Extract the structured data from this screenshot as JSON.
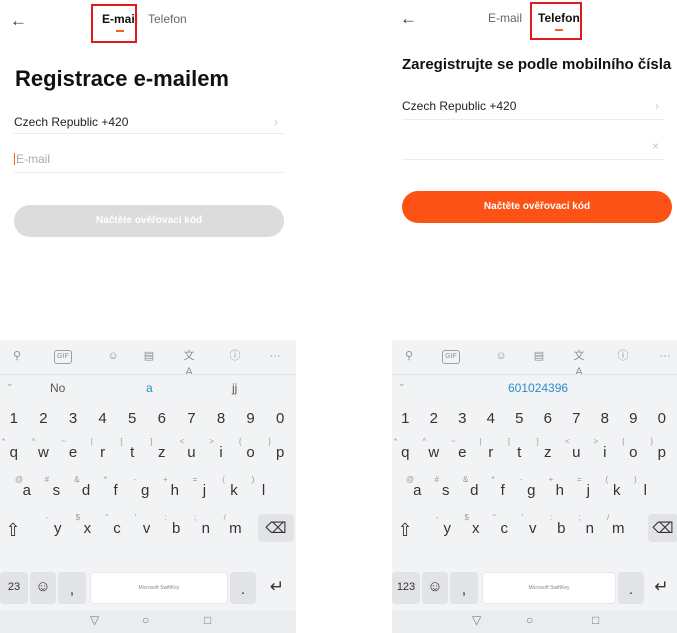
{
  "left": {
    "tabs": {
      "email": "E-mail",
      "phone": "Telefon"
    },
    "title": "Registrace e-mailem",
    "country": "Czech Republic +420",
    "email_placeholder": "E-mail",
    "submit": "Načtěte ověřovací kód",
    "keyboard": {
      "suggestions": [
        "No",
        "a",
        "jj"
      ],
      "numbers": [
        "1",
        "2",
        "3",
        "4",
        "5",
        "6",
        "7",
        "8",
        "9",
        "0"
      ],
      "row1": [
        [
          "*",
          "q"
        ],
        [
          "^",
          "w"
        ],
        [
          "~",
          "e"
        ],
        [
          "|",
          "r"
        ],
        [
          "[",
          "t"
        ],
        [
          "]",
          "z"
        ],
        [
          "<",
          "u"
        ],
        [
          ">",
          "i"
        ],
        [
          "{",
          "o"
        ],
        [
          "}",
          "p"
        ]
      ],
      "row2": [
        [
          "@",
          "a"
        ],
        [
          "#",
          "s"
        ],
        [
          "&",
          "d"
        ],
        [
          "*",
          "f"
        ],
        [
          "-",
          "g"
        ],
        [
          "+",
          "h"
        ],
        [
          "=",
          "j"
        ],
        [
          "(",
          "k"
        ],
        [
          ")",
          "l"
        ]
      ],
      "row3": [
        [
          "-",
          "y"
        ],
        [
          "$",
          "x"
        ],
        [
          "\"",
          "c"
        ],
        [
          "'",
          "v"
        ],
        [
          ":",
          "b"
        ],
        [
          ";",
          "n"
        ],
        [
          "/",
          "m"
        ]
      ],
      "num_toggle": "23",
      "space_label": "Microsoft SwiftKey",
      "comma": ",",
      "period": "."
    }
  },
  "right": {
    "tabs": {
      "email": "E-mail",
      "phone": "Telefon"
    },
    "title": "Zaregistrujte se podle mobilního čísla",
    "country": "Czech Republic +420",
    "submit": "Načtěte ověřovací kód",
    "keyboard": {
      "suggestion": "601024396",
      "numbers": [
        "1",
        "2",
        "3",
        "4",
        "5",
        "6",
        "7",
        "8",
        "9",
        "0"
      ],
      "row1": [
        [
          "*",
          "q"
        ],
        [
          "^",
          "w"
        ],
        [
          "~",
          "e"
        ],
        [
          "|",
          "r"
        ],
        [
          "[",
          "t"
        ],
        [
          "]",
          "z"
        ],
        [
          "<",
          "u"
        ],
        [
          ">",
          "i"
        ],
        [
          "{",
          "o"
        ],
        [
          "}",
          "p"
        ]
      ],
      "row2": [
        [
          "@",
          "a"
        ],
        [
          "#",
          "s"
        ],
        [
          "&",
          "d"
        ],
        [
          "*",
          "f"
        ],
        [
          "-",
          "g"
        ],
        [
          "+",
          "h"
        ],
        [
          "=",
          "j"
        ],
        [
          "(",
          "k"
        ],
        [
          ")",
          "l"
        ]
      ],
      "row3": [
        [
          "-",
          "y"
        ],
        [
          "$",
          "x"
        ],
        [
          "\"",
          "c"
        ],
        [
          "'",
          "v"
        ],
        [
          ":",
          "b"
        ],
        [
          ";",
          "n"
        ],
        [
          "/",
          "m"
        ]
      ],
      "num_toggle": "123",
      "space_label": "Microsoft SwiftKey",
      "comma": ",",
      "period": "."
    }
  },
  "icons": {
    "back": "←",
    "chevron": "›",
    "clear": "×",
    "search": "⚲",
    "gif": "GIF",
    "sticker": "☺",
    "clipboard": "▤",
    "translate": "文A",
    "info": "ⓘ",
    "more": "···",
    "expand": "⌄",
    "shift": "⇧",
    "backspace": "⌫",
    "emoji": "☺",
    "enter": "↵",
    "nav_back": "▽",
    "nav_home": "○",
    "nav_recent": "□"
  },
  "colors": {
    "accent": "#fc5215",
    "highlight_box": "#e01b1b",
    "disabled_button": "#dcdcdc"
  }
}
